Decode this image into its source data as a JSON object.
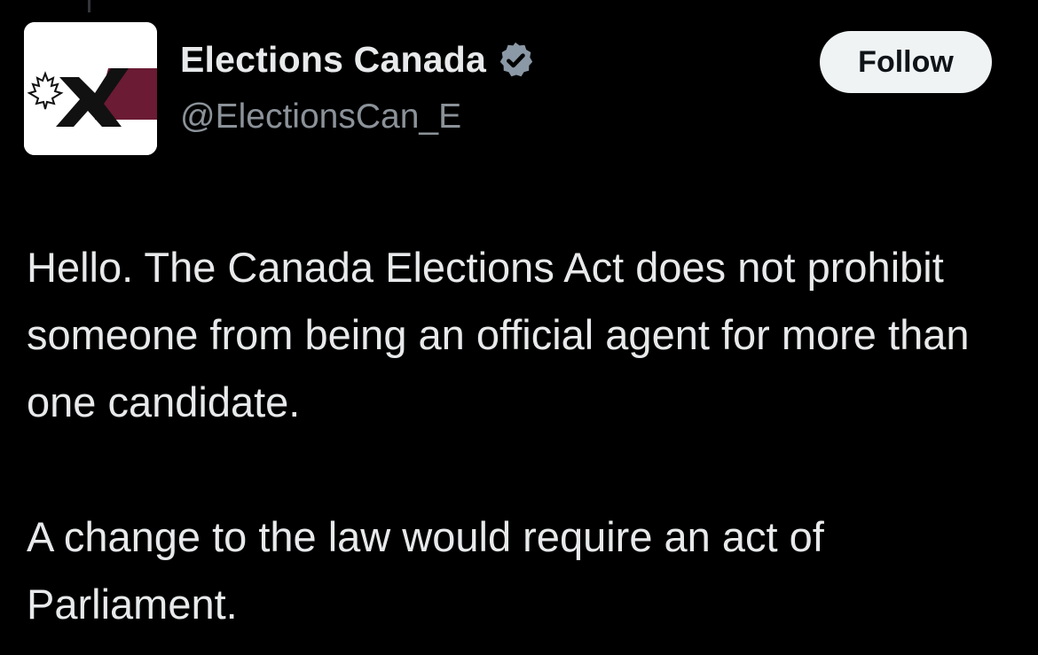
{
  "author": {
    "display_name": "Elections Canada",
    "handle": "@ElectionsCan_E",
    "verified": true,
    "avatar_icon": "elections-canada-logo-icon",
    "verified_icon": "verified-badge-icon"
  },
  "actions": {
    "follow_label": "Follow"
  },
  "tweet": {
    "paragraphs": [
      "Hello. The Canada Elections Act does not prohibit someone from being an official agent for more than one candidate.",
      "A change to the law would require an act of Parliament."
    ]
  },
  "colors": {
    "background": "#000000",
    "text_primary": "#e7e9ea",
    "text_secondary": "#8b9299",
    "follow_bg": "#eff3f4",
    "logo_maroon": "#6b1b34",
    "badge_gray": "#8b98a5"
  }
}
